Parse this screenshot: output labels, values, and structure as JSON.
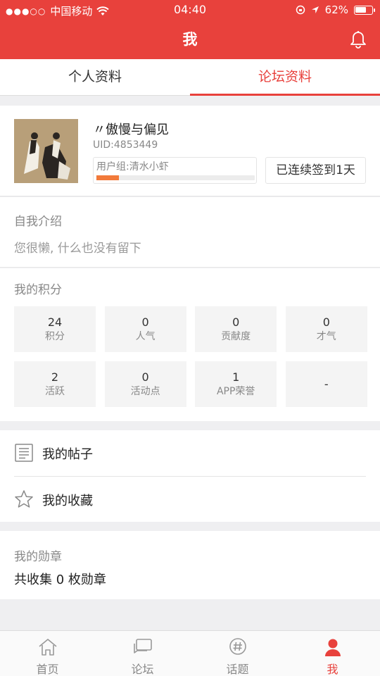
{
  "status_bar": {
    "carrier": "中国移动",
    "time": "04:40",
    "battery": "62%"
  },
  "header": {
    "title": "我"
  },
  "tabs": [
    {
      "label": "个人资料",
      "active": false
    },
    {
      "label": "论坛资料",
      "active": true
    }
  ],
  "profile": {
    "username": "〃傲慢与偏见",
    "uid": "UID:4853449",
    "group_label": "用户组:清水小虾",
    "group_progress": 0.14,
    "checkin_label": "已连续签到1天"
  },
  "intro": {
    "title": "自我介绍",
    "text": "您很懒, 什么也没有留下"
  },
  "scores": {
    "title": "我的积分",
    "items": [
      {
        "value": "24",
        "label": "积分"
      },
      {
        "value": "0",
        "label": "人气"
      },
      {
        "value": "0",
        "label": "贡献度"
      },
      {
        "value": "0",
        "label": "才气"
      },
      {
        "value": "2",
        "label": "活跃"
      },
      {
        "value": "0",
        "label": "活动点"
      },
      {
        "value": "1",
        "label": "APP荣誉"
      },
      {
        "value": "-",
        "label": ""
      }
    ]
  },
  "menu": {
    "posts_label": "我的帖子",
    "favorites_label": "我的收藏"
  },
  "medals": {
    "title": "我的勋章",
    "count_text": "共收集 0 枚勋章"
  },
  "bottom_nav": [
    {
      "label": "首页",
      "icon": "home-icon",
      "active": false
    },
    {
      "label": "论坛",
      "icon": "forum-icon",
      "active": false
    },
    {
      "label": "话题",
      "icon": "topic-icon",
      "active": false
    },
    {
      "label": "我",
      "icon": "user-icon",
      "active": true
    }
  ],
  "colors": {
    "accent": "#e8413c",
    "progress": "#f27a3a"
  }
}
